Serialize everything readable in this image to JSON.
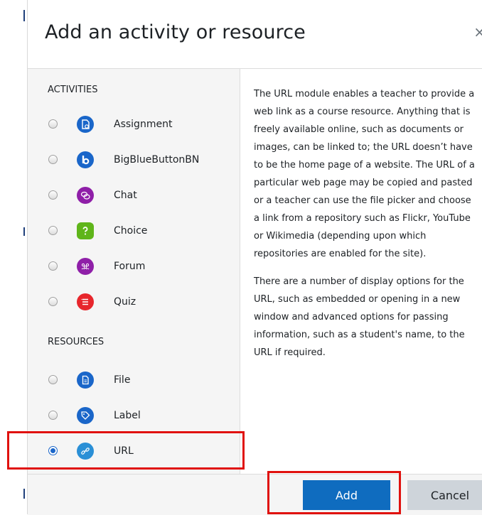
{
  "dialog": {
    "title": "Add an activity or resource",
    "close_symbol": "×"
  },
  "sections": {
    "activities_label": "ACTIVITIES",
    "resources_label": "RESOURCES"
  },
  "activities": [
    {
      "label": "Assignment",
      "icon": "assignment-icon",
      "color": "#1a66c9",
      "selected": false
    },
    {
      "label": "BigBlueButtonBN",
      "icon": "bigbluebutton-icon",
      "color": "#1a66c9",
      "selected": false
    },
    {
      "label": "Chat",
      "icon": "chat-icon",
      "color": "#8f1fa8",
      "selected": false
    },
    {
      "label": "Choice",
      "icon": "choice-icon",
      "color": "#5fb51a",
      "selected": false
    },
    {
      "label": "Forum",
      "icon": "forum-icon",
      "color": "#8f1fa8",
      "selected": false
    },
    {
      "label": "Quiz",
      "icon": "quiz-icon",
      "color": "#e7262c",
      "selected": false
    }
  ],
  "resources": [
    {
      "label": "File",
      "icon": "file-icon",
      "color": "#1a66c9",
      "selected": false
    },
    {
      "label": "Label",
      "icon": "label-icon",
      "color": "#1a66c9",
      "selected": false
    },
    {
      "label": "URL",
      "icon": "url-icon",
      "color": "#2a8fd6",
      "selected": true
    }
  ],
  "description": {
    "p1": "The URL module enables a teacher to provide a web link as a course resource. Anything that is freely available online, such as documents or images, can be linked to; the URL doesn’t have to be the home page of a website. The URL of a particular web page may be copied and pasted or a teacher can use the file picker and choose a link from a repository such as Flickr, YouTube or Wikimedia (depending upon which repositories are enabled for the site).",
    "p2": "There are a number of display options for the URL, such as embedded or opening in a new window and advanced options for passing information, such as a student's name, to the URL if required."
  },
  "footer": {
    "add_label": "Add",
    "cancel_label": "Cancel"
  },
  "colors": {
    "primary": "#0f6cbf",
    "highlight": "#e0110e"
  }
}
